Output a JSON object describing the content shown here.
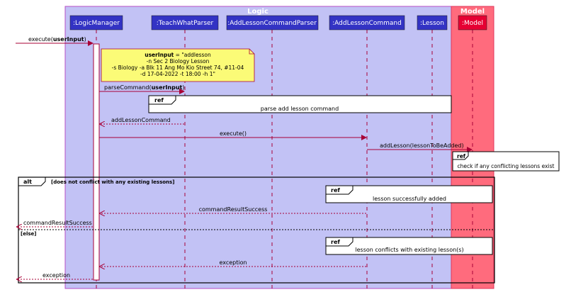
{
  "boxes": {
    "logic": "Logic",
    "model": "Model"
  },
  "participants": {
    "logic_manager": ":LogicManager",
    "teach_what_parser": ":TeachWhatParser",
    "add_lesson_parser": ":AddLessonCommandParser",
    "add_lesson_command": ":AddLessonCommand",
    "lesson": ":Lesson",
    "model": ":Model"
  },
  "note": {
    "line1_bold": "userInput",
    "line1_rest": " = \"addlesson",
    "line2": "-n Sec 2 Biology Lesson",
    "line3": "-s Biology -a Blk 11 Ang Mo Kio Street 74, #11-04",
    "line4": "-d 17-04-2022 -t 18:00 -h 1\""
  },
  "messages": {
    "execute_prefix": "execute(",
    "execute_arg": "userInput",
    "execute_suffix": ")",
    "parse_prefix": "parseCommand(",
    "parse_arg": "userInput",
    "parse_suffix": ")",
    "add_lesson_command": "addLessonCommand",
    "execute_call": "execute()",
    "add_lesson_call": "addLesson(lessonToBeAdded)",
    "command_result_success_1": "commandResultSuccess",
    "command_result_success_2": "commandResultSuccess",
    "exception_1": "exception",
    "exception_2": "exception"
  },
  "refs": {
    "keyword": "ref",
    "parse_add_lesson": "parse add lesson command",
    "check_conflicts": "check if any conflicting lessons exist",
    "lesson_added": "lesson successfully added",
    "lesson_conflicts": "lesson conflicts with existing lesson(s)"
  },
  "alt": {
    "keyword": "alt",
    "guard_1": "[does not conflict with any existing lessons]",
    "guard_2": "[else]"
  },
  "colors": {
    "logic_box": "#C2C2F5",
    "logic_border": "#B64FC4",
    "model_box": "#FF6B7D",
    "model_border": "#E0355A",
    "participant_fill": "#3333C4",
    "model_participant_fill": "#E60033",
    "arrow": "#A80036",
    "note_fill": "#FBFB77"
  }
}
